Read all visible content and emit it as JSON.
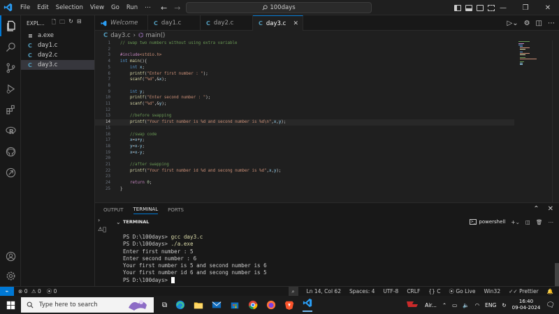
{
  "titlebar": {
    "menu": [
      "File",
      "Edit",
      "Selection",
      "View",
      "Go",
      "Run",
      "⋯"
    ],
    "search_text": "100days"
  },
  "sidebar": {
    "header": "EXPL...",
    "files": [
      {
        "name": "a.exe",
        "icon": "≡",
        "type": "exe"
      },
      {
        "name": "day1.c",
        "icon": "C",
        "type": "c"
      },
      {
        "name": "day2.c",
        "icon": "C",
        "type": "c"
      },
      {
        "name": "day3.c",
        "icon": "C",
        "type": "c"
      }
    ]
  },
  "tabs": [
    {
      "label": "Welcome"
    },
    {
      "label": "day1.c"
    },
    {
      "label": "day2.c"
    },
    {
      "label": "day3.c"
    }
  ],
  "breadcrumb": {
    "file": "day3.c",
    "symbol": "main()"
  },
  "editor": {
    "current_line": 14,
    "lines": [
      [
        [
          "cm",
          "// swap two numbers without using extra variable"
        ]
      ],
      [],
      [
        [
          "pp",
          "#include"
        ],
        [
          "str",
          "<stdio.h>"
        ]
      ],
      [
        [
          "kw",
          "int "
        ],
        [
          "fn",
          "main"
        ],
        [
          "plain",
          "(){"
        ]
      ],
      [
        [
          "plain",
          "    "
        ],
        [
          "kw",
          "int "
        ],
        [
          "var",
          "x"
        ],
        [
          "plain",
          ";"
        ]
      ],
      [
        [
          "plain",
          "    "
        ],
        [
          "fn",
          "printf"
        ],
        [
          "plain",
          "("
        ],
        [
          "str",
          "\"Enter first number : \""
        ],
        [
          "plain",
          ");"
        ]
      ],
      [
        [
          "plain",
          "    "
        ],
        [
          "fn",
          "scanf"
        ],
        [
          "plain",
          "("
        ],
        [
          "str",
          "\"%d\""
        ],
        [
          "plain",
          ",&"
        ],
        [
          "var",
          "x"
        ],
        [
          "plain",
          ");"
        ]
      ],
      [],
      [
        [
          "plain",
          "    "
        ],
        [
          "kw",
          "int "
        ],
        [
          "var",
          "y"
        ],
        [
          "plain",
          ";"
        ]
      ],
      [
        [
          "plain",
          "    "
        ],
        [
          "fn",
          "printf"
        ],
        [
          "plain",
          "("
        ],
        [
          "str",
          "\"Enter second number : \""
        ],
        [
          "plain",
          ");"
        ]
      ],
      [
        [
          "plain",
          "    "
        ],
        [
          "fn",
          "scanf"
        ],
        [
          "plain",
          "("
        ],
        [
          "str",
          "\"%d\""
        ],
        [
          "plain",
          ",&"
        ],
        [
          "var",
          "y"
        ],
        [
          "plain",
          ");"
        ]
      ],
      [],
      [
        [
          "plain",
          "    "
        ],
        [
          "cm",
          "//before swapping"
        ]
      ],
      [
        [
          "plain",
          "    "
        ],
        [
          "fn",
          "printf"
        ],
        [
          "plain",
          "("
        ],
        [
          "str",
          "\"Your first number is %d and second number is %d\\n\""
        ],
        [
          "plain",
          ","
        ],
        [
          "var",
          "x"
        ],
        [
          "plain",
          ","
        ],
        [
          "var",
          "y"
        ],
        [
          "plain",
          ");"
        ]
      ],
      [],
      [
        [
          "plain",
          "    "
        ],
        [
          "cm",
          "//swap code"
        ]
      ],
      [
        [
          "plain",
          "    "
        ],
        [
          "var",
          "x"
        ],
        [
          "plain",
          "="
        ],
        [
          "var",
          "x"
        ],
        [
          "plain",
          "+"
        ],
        [
          "var",
          "y"
        ],
        [
          "plain",
          ";"
        ]
      ],
      [
        [
          "plain",
          "    "
        ],
        [
          "var",
          "y"
        ],
        [
          "plain",
          "="
        ],
        [
          "var",
          "x"
        ],
        [
          "plain",
          "-"
        ],
        [
          "var",
          "y"
        ],
        [
          "plain",
          ";"
        ]
      ],
      [
        [
          "plain",
          "    "
        ],
        [
          "var",
          "x"
        ],
        [
          "plain",
          "="
        ],
        [
          "var",
          "x"
        ],
        [
          "plain",
          "-"
        ],
        [
          "var",
          "y"
        ],
        [
          "plain",
          ";"
        ]
      ],
      [],
      [
        [
          "plain",
          "    "
        ],
        [
          "cm",
          "//after swapping"
        ]
      ],
      [
        [
          "plain",
          "    "
        ],
        [
          "fn",
          "printf"
        ],
        [
          "plain",
          "("
        ],
        [
          "str",
          "\"Your first number id %d and secong number is %d\""
        ],
        [
          "plain",
          ","
        ],
        [
          "var",
          "x"
        ],
        [
          "plain",
          ","
        ],
        [
          "var",
          "y"
        ],
        [
          "plain",
          ");"
        ]
      ],
      [],
      [
        [
          "plain",
          "    "
        ],
        [
          "pp",
          "return "
        ],
        [
          "num",
          "0"
        ],
        [
          "plain",
          ";"
        ]
      ],
      [
        [
          "plain",
          "}"
        ]
      ]
    ]
  },
  "panel": {
    "tabs": [
      "OUTPUT",
      "TERMINAL",
      "PORTS"
    ],
    "active_tab": "TERMINAL",
    "terminal_title": "TERMINAL",
    "shell": "powershell",
    "terminal_lines": [
      {
        "prompt": "PS D:\\100days> ",
        "cmd": "gcc day3.c"
      },
      {
        "prompt": "PS D:\\100days> ",
        "cmd": "./a.exe"
      },
      {
        "text": "Enter first number : 5"
      },
      {
        "text": "Enter second number : 6"
      },
      {
        "text": "Your first number is 5 and second number is 6"
      },
      {
        "text": "Your first number id 6 and secong number is 5"
      },
      {
        "prompt": "PS D:\\100days> ",
        "cursor": true
      }
    ]
  },
  "statusbar": {
    "errors": "0",
    "warnings": "0",
    "ports": "0",
    "position": "Ln 14, Col 62",
    "spaces": "Spaces: 4",
    "encoding": "UTF-8",
    "eol": "CRLF",
    "language": "C",
    "golive": "Go Live",
    "platform": "Win32",
    "prettier": "Prettier"
  },
  "taskbar": {
    "search_placeholder": "Type here to search",
    "weather": "Air...",
    "lang": "ENG",
    "time": "16:40",
    "date": "09-04-2024"
  },
  "colors": {
    "accent": "#0078d4",
    "editor_bg": "#1f1f1f",
    "sidebar_bg": "#181818"
  }
}
